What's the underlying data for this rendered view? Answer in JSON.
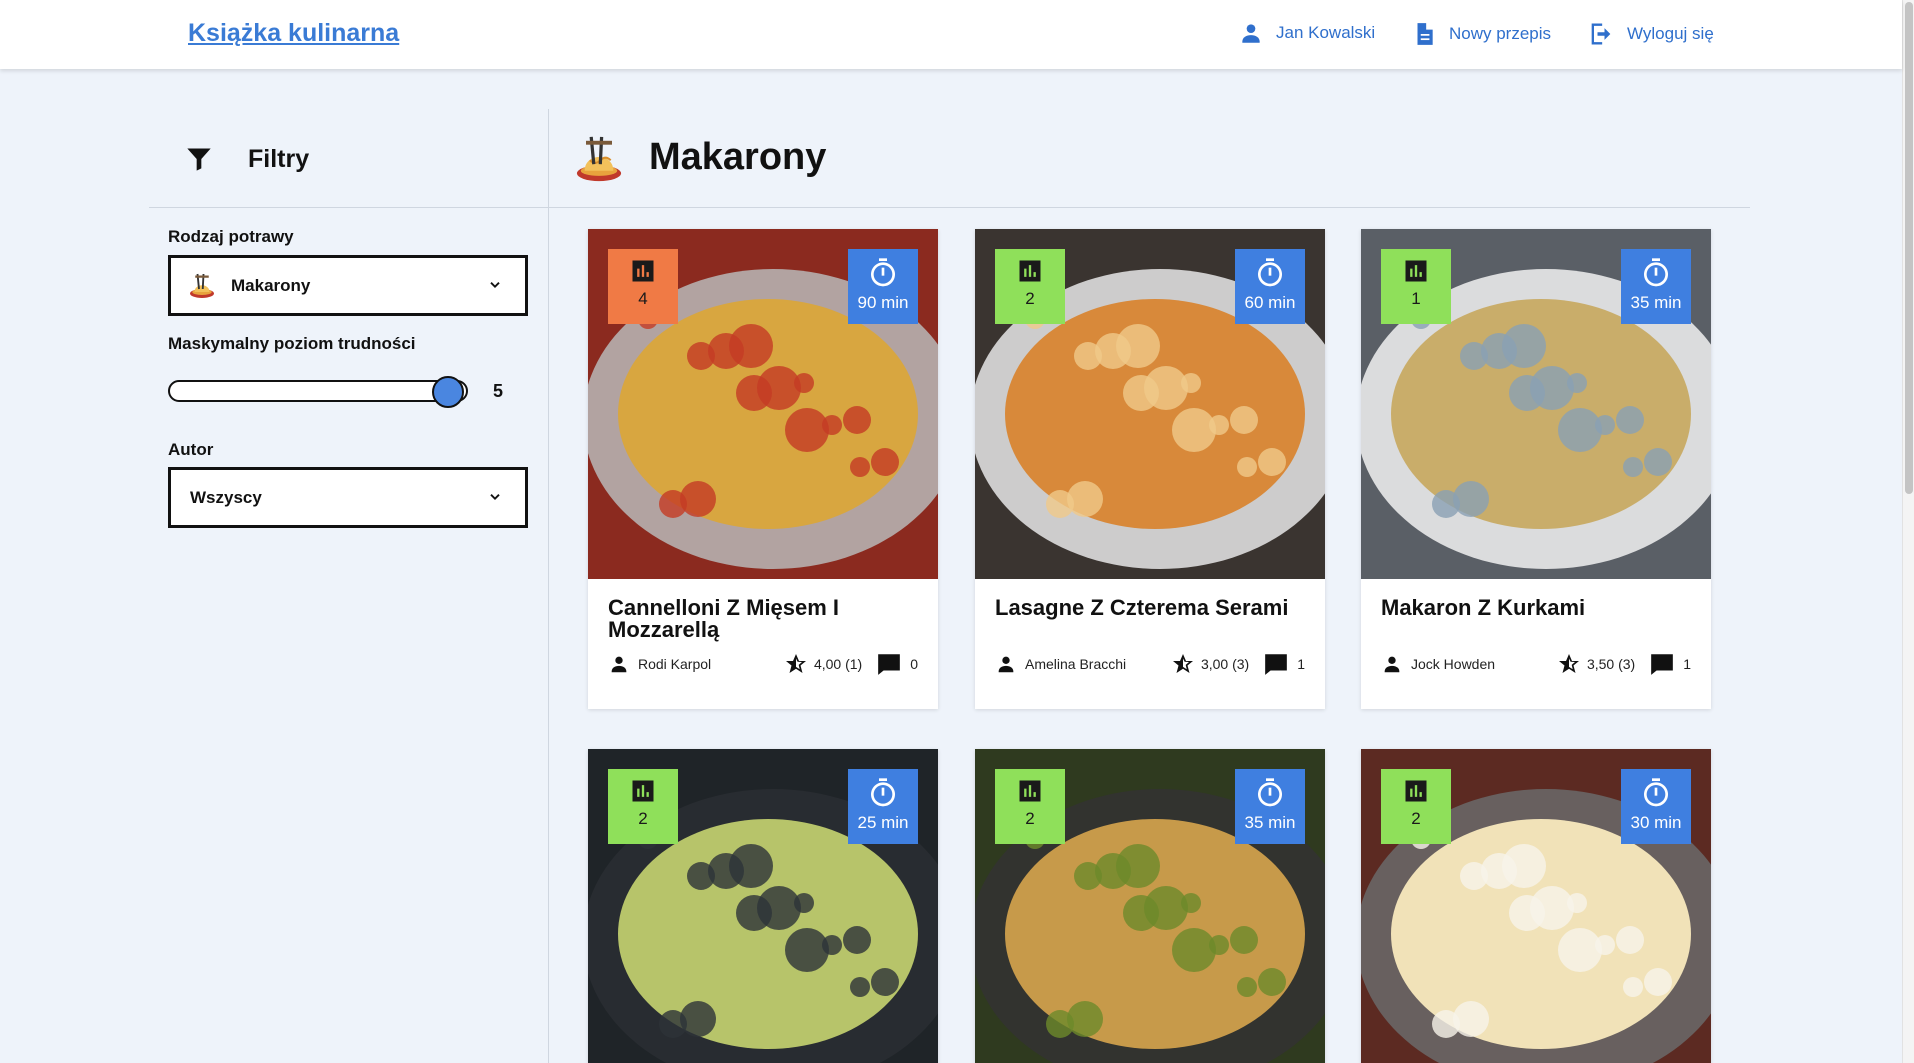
{
  "header": {
    "brand": "Książka kulinarna",
    "user": "Jan Kowalski",
    "new_recipe": "Nowy przepis",
    "logout": "Wyloguj się"
  },
  "sidebar": {
    "title": "Filtry",
    "dish_type_label": "Rodzaj potrawy",
    "dish_type_value": "Makarony",
    "max_difficulty_label": "Maskymalny poziom trudności",
    "max_difficulty_value": "5",
    "max_difficulty_level": 1.0,
    "author_label": "Autor",
    "author_value": "Wszyscy"
  },
  "main": {
    "title": "Makarony"
  },
  "colors": {
    "brand": "#3a7bd5",
    "time_badge": "#3f7fe0",
    "difficulty_high": "#f07a45",
    "difficulty_low": "#8fe05a"
  },
  "recipes": [
    {
      "title": "Cannelloni Z Mięsem I Mozzarellą",
      "difficulty": "4",
      "time": "90 min",
      "author": "Rodi Karpol",
      "rating": "4,00 (1)",
      "comments": "0",
      "difficulty_color": "#f07a45"
    },
    {
      "title": "Lasagne Z Czterema Serami",
      "difficulty": "2",
      "time": "60 min",
      "author": "Amelina Bracchi",
      "rating": "3,00 (3)",
      "comments": "1",
      "difficulty_color": "#8fe05a"
    },
    {
      "title": "Makaron Z Kurkami",
      "difficulty": "1",
      "time": "35 min",
      "author": "Jock Howden",
      "rating": "3,50 (3)",
      "comments": "1",
      "difficulty_color": "#8fe05a"
    },
    {
      "title": "",
      "difficulty": "2",
      "time": "25 min",
      "author": "",
      "rating": "",
      "comments": "",
      "difficulty_color": "#8fe05a"
    },
    {
      "title": "",
      "difficulty": "2",
      "time": "35 min",
      "author": "",
      "rating": "",
      "comments": "",
      "difficulty_color": "#8fe05a"
    },
    {
      "title": "",
      "difficulty": "2",
      "time": "30 min",
      "author": "",
      "rating": "",
      "comments": "",
      "difficulty_color": "#8fe05a"
    }
  ]
}
